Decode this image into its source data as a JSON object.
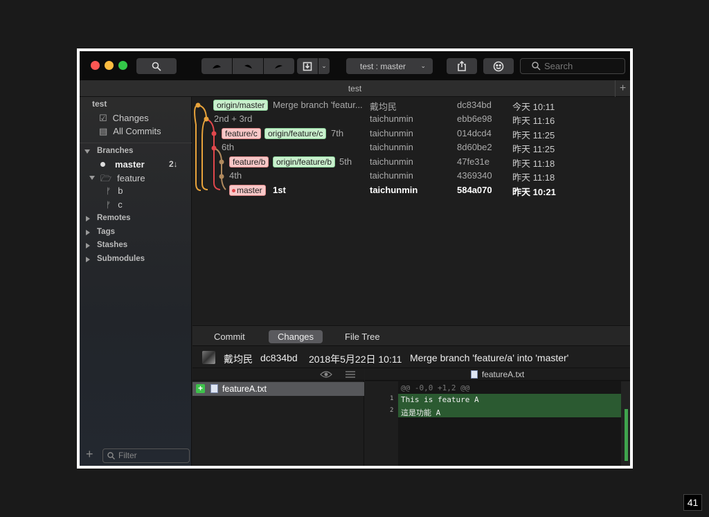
{
  "window": {
    "tab_title": "test",
    "branch_selector": "test :  master",
    "search_placeholder": "Search",
    "icons": [
      "search-icon",
      "fetch-icon",
      "pull-icon",
      "push-icon",
      "stash-icon",
      "share-icon",
      "emoji-icon"
    ]
  },
  "sidebar": {
    "repo": "test",
    "changes": "Changes",
    "all_commits": "All Commits",
    "branches_header": "Branches",
    "master": "master",
    "master_badge": "2↓",
    "feature_folder": "feature",
    "branch_b": "b",
    "branch_c": "c",
    "remotes": "Remotes",
    "tags": "Tags",
    "stashes": "Stashes",
    "submodules": "Submodules",
    "filter_placeholder": "Filter",
    "add_icon": "plus-icon"
  },
  "commits": [
    {
      "refs": [
        "origin/master"
      ],
      "ref_colors": [
        "green"
      ],
      "message": "Merge branch 'featur...",
      "author": "戴均民",
      "hash": "dc834bd",
      "date": "今天 10:11"
    },
    {
      "refs": [],
      "message": "2nd + 3rd",
      "author": "taichunmin",
      "hash": "ebb6e98",
      "date": "昨天 11:16"
    },
    {
      "refs": [
        "feature/c",
        "origin/feature/c"
      ],
      "ref_colors": [
        "red",
        "green"
      ],
      "message": "7th",
      "author": "taichunmin",
      "hash": "014dcd4",
      "date": "昨天 11:25"
    },
    {
      "refs": [],
      "message": "6th",
      "author": "taichunmin",
      "hash": "8d60be2",
      "date": "昨天 11:25"
    },
    {
      "refs": [
        "feature/b",
        "origin/feature/b"
      ],
      "ref_colors": [
        "red",
        "green"
      ],
      "message": "5th",
      "author": "taichunmin",
      "hash": "47fe31e",
      "date": "昨天 11:18"
    },
    {
      "refs": [],
      "message": "4th",
      "author": "taichunmin",
      "hash": "4369340",
      "date": "昨天 11:18"
    },
    {
      "refs": [
        "master"
      ],
      "ref_colors": [
        "red"
      ],
      "message": "1st",
      "author": "taichunmin",
      "hash": "584a070",
      "date": "昨天 10:21",
      "bold": true
    }
  ],
  "bottom_tabs": {
    "commit": "Commit",
    "changes": "Changes",
    "file_tree": "File Tree"
  },
  "commit_info": {
    "author": "戴均民",
    "hash": "dc834bd",
    "date": "2018年5月22日 10:11",
    "message": "Merge branch 'feature/a' into 'master'"
  },
  "files": [
    {
      "name": "featureA.txt",
      "status": "added"
    }
  ],
  "diff": {
    "filename": "featureA.txt",
    "hunk": "@@ -0,0 +1,2 @@",
    "lines": [
      {
        "num": "1",
        "text": "This is feature A"
      },
      {
        "num": "2",
        "text": "這是功能 A"
      }
    ]
  },
  "page_number": "41",
  "colors": {
    "added_green": "#2b5a31",
    "badge_green": "#c9f0cd",
    "badge_red": "#f8c8c8",
    "graph_orange": "#e8a33b",
    "graph_red": "#e0474c",
    "graph_tan": "#b08a5e"
  }
}
